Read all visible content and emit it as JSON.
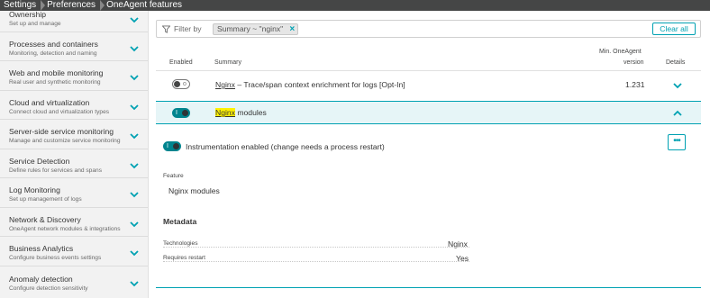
{
  "breadcrumb": [
    "Settings",
    "Preferences",
    "OneAgent features"
  ],
  "sidebar": {
    "items": [
      {
        "title": "Ownership",
        "subtitle": "Set up and manage"
      },
      {
        "title": "Processes and containers",
        "subtitle": "Monitoring, detection and naming"
      },
      {
        "title": "Web and mobile monitoring",
        "subtitle": "Real user and synthetic monitoring"
      },
      {
        "title": "Cloud and virtualization",
        "subtitle": "Connect cloud and virtualization types"
      },
      {
        "title": "Server-side service monitoring",
        "subtitle": "Manage and customize service monitoring"
      },
      {
        "title": "Service Detection",
        "subtitle": "Define rules for services and spans"
      },
      {
        "title": "Log Monitoring",
        "subtitle": "Set up management of logs"
      },
      {
        "title": "Network & Discovery",
        "subtitle": "OneAgent network modules & integrations"
      },
      {
        "title": "Business Analytics",
        "subtitle": "Configure business events settings"
      },
      {
        "title": "Anomaly detection",
        "subtitle": "Configure detection sensitivity"
      }
    ]
  },
  "filter": {
    "label": "Filter by",
    "chip": "Summary ~ \"nginx\"",
    "clear_label": "Clear all"
  },
  "table": {
    "headers": {
      "enabled": "Enabled",
      "summary": "Summary",
      "min_version_line1": "Min. OneAgent",
      "min_version_line2": "version",
      "details": "Details"
    },
    "rows": [
      {
        "highlight": "Nginx",
        "summary_rest": " – Trace/span context enrichment for logs [Opt-In]",
        "version": "1.231",
        "enabled": false
      },
      {
        "highlight": "Nginx",
        "summary_rest": " modules",
        "version": "",
        "enabled": true
      }
    ]
  },
  "detail": {
    "instrumentation_label": "Instrumentation enabled (change needs a process restart)",
    "more_label": "•••",
    "feature_heading": "Feature",
    "feature_value": "Nginx modules",
    "metadata_heading": "Metadata",
    "metadata": [
      {
        "key": "Technologies",
        "value": "Nginx"
      },
      {
        "key": "Requires restart",
        "value": "Yes"
      }
    ]
  },
  "colors": {
    "accent": "#00a1b2",
    "toggle_on": "#00848e",
    "highlight": "#fff200",
    "breadcrumb_bg": "#454646"
  }
}
